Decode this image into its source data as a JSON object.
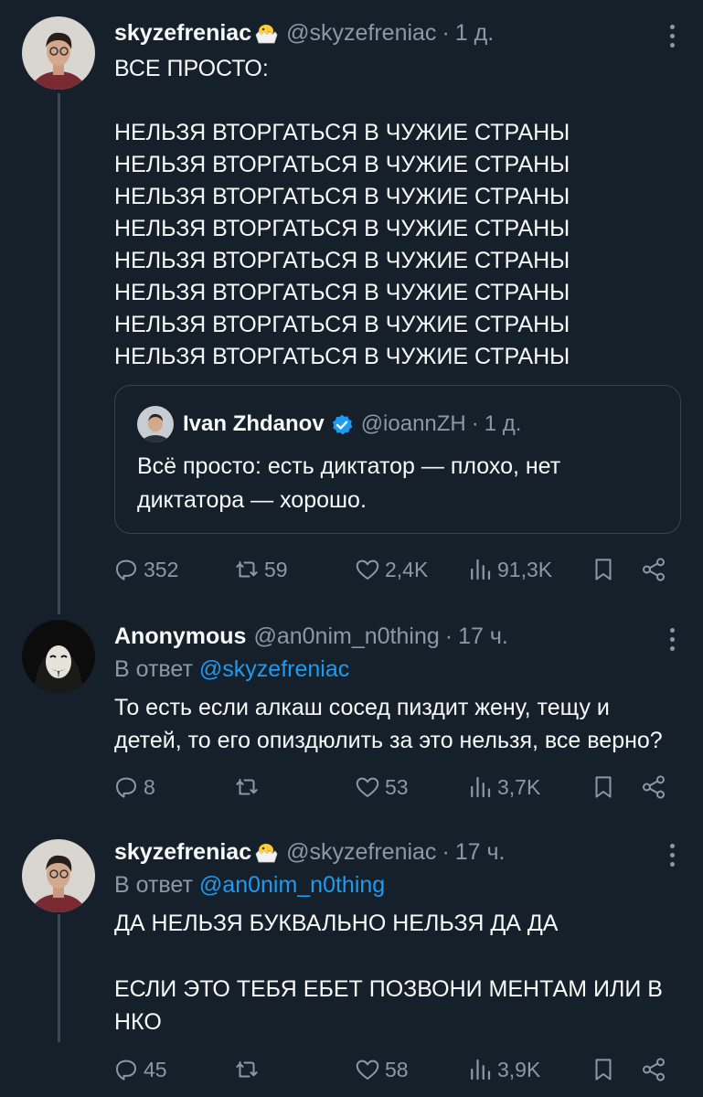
{
  "tweets": [
    {
      "name": "skyzefreniac",
      "handle": "@skyzefreniac",
      "time": "1 д.",
      "text": "ВСЕ ПРОСТО:\n\nНЕЛЬЗЯ ВТОРГАТЬСЯ В ЧУЖИЕ СТРАНЫ\nНЕЛЬЗЯ ВТОРГАТЬСЯ В ЧУЖИЕ СТРАНЫ\nНЕЛЬЗЯ ВТОРГАТЬСЯ В ЧУЖИЕ СТРАНЫ\nНЕЛЬЗЯ ВТОРГАТЬСЯ В ЧУЖИЕ СТРАНЫ\nНЕЛЬЗЯ ВТОРГАТЬСЯ В ЧУЖИЕ СТРАНЫ\nНЕЛЬЗЯ ВТОРГАТЬСЯ В ЧУЖИЕ СТРАНЫ\nНЕЛЬЗЯ ВТОРГАТЬСЯ В ЧУЖИЕ СТРАНЫ\nНЕЛЬЗЯ ВТОРГАТЬСЯ В ЧУЖИЕ СТРАНЫ",
      "quote": {
        "name": "Ivan Zhdanov",
        "handle": "@ioannZH",
        "time": "1 д.",
        "text": "Всё просто: есть диктатор — плохо, нет диктатора — хорошо."
      },
      "stats": {
        "replies": "352",
        "retweets": "59",
        "likes": "2,4K",
        "views": "91,3K"
      }
    },
    {
      "name": "Anonymous",
      "handle": "@an0nim_n0thing",
      "time": "17 ч.",
      "reply_prefix": "В ответ",
      "reply_to": "@skyzefreniac",
      "text": "То есть если алкаш сосед пиздит жену, тещу и детей, то его опиздюлить за это нельзя, все верно?",
      "stats": {
        "replies": "8",
        "retweets": "",
        "likes": "53",
        "views": "3,7K"
      }
    },
    {
      "name": "skyzefreniac",
      "handle": "@skyzefreniac",
      "time": "17 ч.",
      "reply_prefix": "В ответ",
      "reply_to": "@an0nim_n0thing",
      "text": "ДА НЕЛЬЗЯ БУКВАЛЬНО НЕЛЬЗЯ ДА ДА\n\nЕСЛИ ЭТО ТЕБЯ ЕБЕТ ПОЗВОНИ МЕНТАМ ИЛИ В НКО",
      "stats": {
        "replies": "45",
        "retweets": "",
        "likes": "58",
        "views": "3,9K"
      }
    }
  ],
  "colors": {
    "background": "#15202b",
    "text": "#f7f9f9",
    "muted": "#8b98a5",
    "accent": "#1d9bf0",
    "border": "#38444d"
  },
  "icons": [
    "chick-emoji-icon",
    "verified-badge-icon",
    "more-icon",
    "reply-icon",
    "retweet-icon",
    "like-icon",
    "views-icon",
    "bookmark-icon",
    "share-icon"
  ]
}
